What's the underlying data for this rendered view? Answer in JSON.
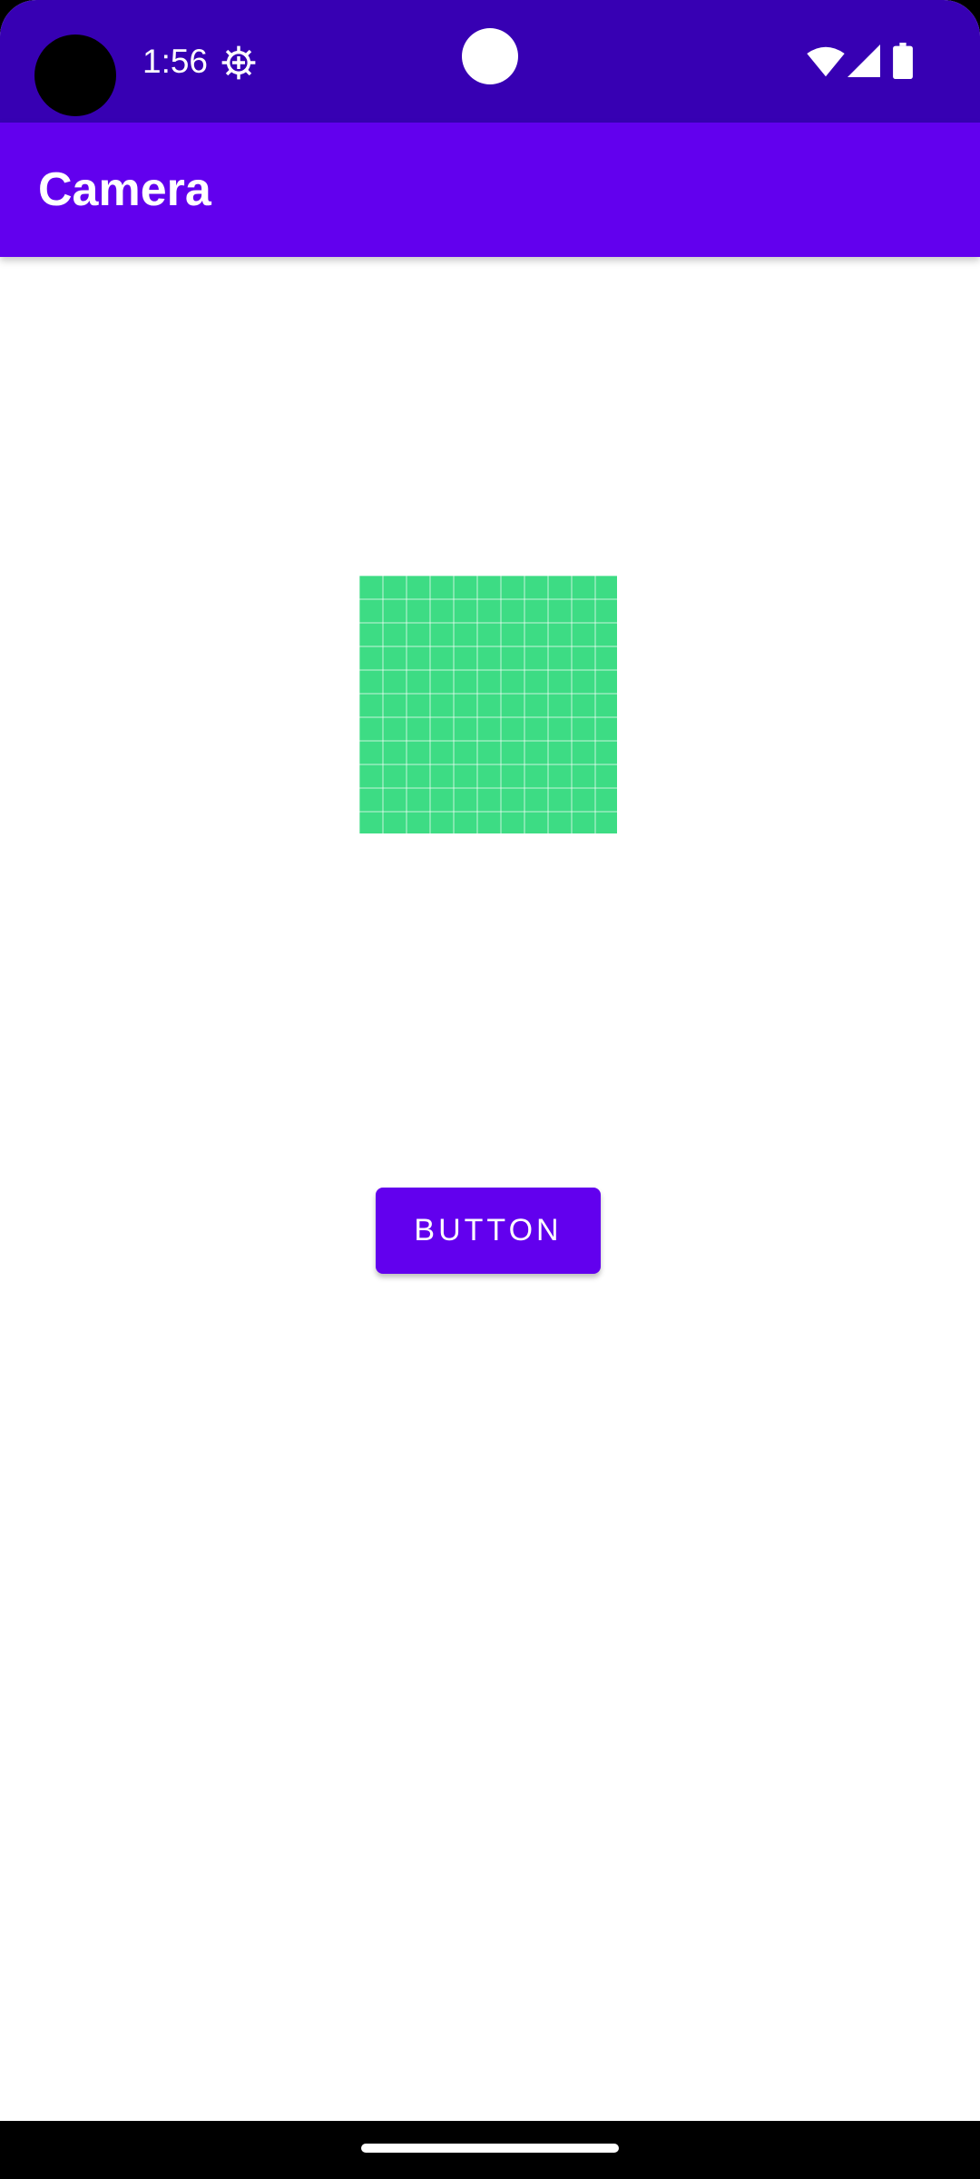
{
  "status_bar": {
    "time": "1:56",
    "icons": [
      "camera-cutout",
      "gear-icon",
      "notification-dot",
      "wifi-icon",
      "signal-icon",
      "battery-icon"
    ],
    "background_color": "#3700B3"
  },
  "app_bar": {
    "title": "Camera",
    "background_color": "#6200EE"
  },
  "main": {
    "image_placeholder": {
      "icon": "image-placeholder-grid",
      "color": "#3DDC84"
    },
    "button": {
      "label": "BUTTON",
      "color": "#6200EE"
    }
  },
  "nav_bar": {
    "icons": [
      "home-handle"
    ]
  }
}
